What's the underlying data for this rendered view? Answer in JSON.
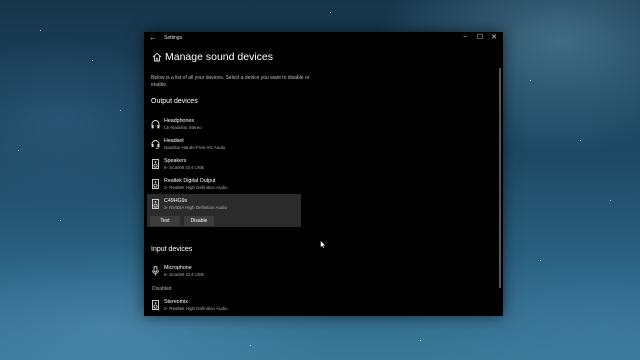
{
  "window": {
    "app_title": "Settings",
    "controls": {
      "minimize": "−",
      "maximize": "☐",
      "close": "✕"
    }
  },
  "page": {
    "title": "Manage sound devices",
    "description": "Below is a list of all your devices. Select a device you want to disable or enable."
  },
  "output_devices": {
    "heading": "Output devices",
    "items": [
      {
        "name": "Headphones",
        "sub": "LE-Nautilus Stereo",
        "icon": "headphones-icon"
      },
      {
        "name": "Headset",
        "sub": "Nautilus Hands-Free AG Audio",
        "icon": "headset-icon"
      },
      {
        "name": "Speakers",
        "sub": "6- Scarlett Gr4 USB",
        "icon": "speaker-icon"
      },
      {
        "name": "Realtek Digital Output",
        "sub": "2- Realtek High Definition Audio",
        "icon": "speaker-icon"
      },
      {
        "name": "C49HG9x",
        "sub": "3- NVIDIA High Definition Audio",
        "icon": "speaker-icon",
        "selected": true
      }
    ],
    "buttons": {
      "test": "Test",
      "disable": "Disable"
    }
  },
  "input_devices": {
    "heading": "Input devices",
    "items": [
      {
        "name": "Microphone",
        "sub": "6- Scarlett Gr4 USB",
        "icon": "microphone-icon"
      }
    ],
    "disabled_label": "Disabled",
    "disabled_items": [
      {
        "name": "Stereomix",
        "sub": "2- Realtek High Definition Audio",
        "icon": "speaker-icon"
      }
    ]
  },
  "colors": {
    "window_bg": "#000000",
    "selected_bg": "#2b2b2b",
    "button_bg": "#3d3d3d",
    "secondary_text": "#aaaaaa"
  }
}
